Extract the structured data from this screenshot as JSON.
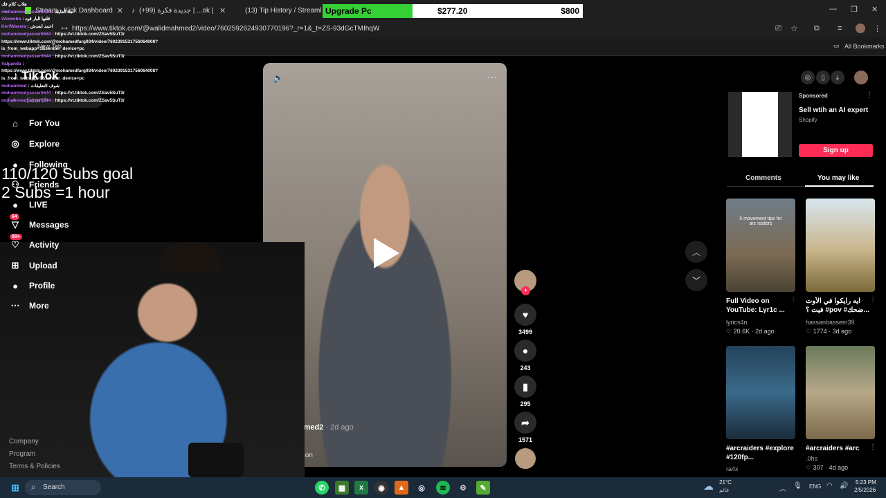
{
  "browser": {
    "tabs": [
      {
        "label": "Stream - Kick Dashboard",
        "icon": "kick-icon"
      },
      {
        "label": "جديدة فكرة (99+) | ...ok | Tok",
        "icon": "tiktok-icon"
      },
      {
        "label": "(13) Tip History / Streamlabs",
        "icon": "streamlabs-icon"
      }
    ],
    "url": "https://www.tiktok.com/@walidmahmed2/video/7602592624930770196?_r=1&_t=ZS-93dGcTMIhqW",
    "new_tab_label": "New Tab",
    "all_bookmarks": "All Bookmarks"
  },
  "upgrade_bar": {
    "label": "Upgrade Pc",
    "current": "$277.20",
    "target": "$800",
    "progress": 0.3465,
    "accent": "#35d035"
  },
  "chat": [
    {
      "user": "",
      "text": "هلاب كلام فك"
    },
    {
      "user": "mohammedyasser6644",
      "text": ": اهلا العايلة"
    },
    {
      "user": "3Aweebo",
      "text": ": قلتها البار قود"
    },
    {
      "user": "KerfWasera",
      "text": ": احمد ابعدش"
    },
    {
      "user": "mohammedyasser6644",
      "text": ": https://vt.tiktok.com/ZSav5SuT3/"
    },
    {
      "user": "",
      "text": "https://www.tiktok.com/@mohamedfarg934/video/7602391531756064008?"
    },
    {
      "user": "",
      "text": "is_from_webapp=1&sender_device=pc"
    },
    {
      "user": "mohammedyasser6644",
      "text": ": https://vt.tiktok.com/ZSav5SuT3/"
    },
    {
      "user": "Valpanda",
      "text": ":"
    },
    {
      "user": "",
      "text": "https://www.tiktok.com/@mohamedfarg934/video/7602391531756064008?"
    },
    {
      "user": "",
      "text": "is_from_webapp=1&sender_device=pc"
    },
    {
      "user": "mohammed",
      "text": ": شوف التعليقات"
    },
    {
      "user": "mohammedyasser6644",
      "text": ": https://vt.tiktok.com/ZSav5SuT3/"
    },
    {
      "user": "mohammedyasser6644",
      "text": ": https://vt.tiktok.com/ZSav5SuT3/"
    }
  ],
  "sidebar": {
    "logo": "TikTok",
    "search_placeholder": "Search",
    "items": [
      {
        "label": "For You",
        "icon": "home-icon"
      },
      {
        "label": "Explore",
        "icon": "compass-icon"
      },
      {
        "label": "Following",
        "icon": "following-icon"
      },
      {
        "label": "Friends",
        "icon": "friends-icon"
      },
      {
        "label": "LIVE",
        "icon": "live-icon"
      },
      {
        "label": "Messages",
        "icon": "messages-icon",
        "badge": "64"
      },
      {
        "label": "Activity",
        "icon": "activity-icon",
        "badge": "99+"
      },
      {
        "label": "Upload",
        "icon": "upload-icon"
      },
      {
        "label": "Profile",
        "icon": "profile-icon"
      },
      {
        "label": "More",
        "icon": "more-icon"
      }
    ],
    "footer": [
      "Company",
      "Program",
      "Terms & Policies"
    ]
  },
  "overlay_goal": {
    "line1": "110/120 Subs goal",
    "line2": "2 Subs =1 hour"
  },
  "video": {
    "author": "mahmed2",
    "age": "· 2d ago",
    "caption": "lation",
    "likes": "3499",
    "comments": "243",
    "saves": "295",
    "shares": "1571"
  },
  "ad": {
    "sponsored": "Sponsored",
    "title": "Sell wtih an AI expert",
    "brand": "Shopify",
    "cta": "Sign up"
  },
  "right_tabs": {
    "comments": "Comments",
    "you_may_like": "You may like"
  },
  "recommendations": [
    {
      "title": "Full Video on YouTube: Lyr1c ...",
      "user": "lyrics4n",
      "likes": "20.6K",
      "age": "2d ago",
      "thumb_text": "5 movement tips for arc raiders"
    },
    {
      "title": "ايه رايكوا في الأوت فيت ؟ #pov #ضحك...",
      "user": "hassanbassem39",
      "likes": "1774",
      "age": "3d ago",
      "thumb_text": ""
    },
    {
      "title": "#arcraiders #explore #120fp...",
      "user": "ra4x",
      "likes": "",
      "age": "",
      "thumb_text": ""
    },
    {
      "title": "#arcraiders #arc",
      "user": ".0hs",
      "likes": "307",
      "age": "4d ago",
      "thumb_text": ""
    }
  ],
  "taskbar": {
    "search_label": "Search",
    "weather": "21°C",
    "weather_sub": "غائم",
    "lang": "ENG",
    "time": "5:23 PM",
    "date": "2/5/2026"
  }
}
